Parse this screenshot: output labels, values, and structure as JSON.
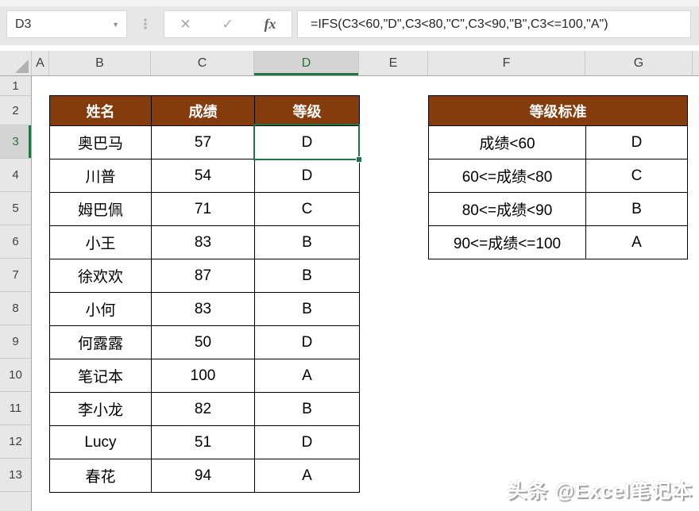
{
  "formula_bar": {
    "name_box_value": "D3",
    "cancel_icon": "✕",
    "enter_icon": "✓",
    "fx_label": "fx",
    "formula": "=IFS(C3<60,\"D\",C3<80,\"C\",C3<90,\"B\",C3<=100,\"A\")"
  },
  "grid": {
    "selected_cell": "D3",
    "column_headers": [
      "A",
      "B",
      "C",
      "D",
      "E",
      "F",
      "G"
    ],
    "row_headers": [
      "1",
      "2",
      "3",
      "4",
      "5",
      "6",
      "7",
      "8",
      "9",
      "10",
      "11",
      "12",
      "13"
    ]
  },
  "score_table": {
    "headers": [
      "姓名",
      "成绩",
      "等级"
    ],
    "rows": [
      {
        "name": "奥巴马",
        "score": "57",
        "grade": "D"
      },
      {
        "name": "川普",
        "score": "54",
        "grade": "D"
      },
      {
        "name": "姆巴佩",
        "score": "71",
        "grade": "C"
      },
      {
        "name": "小王",
        "score": "83",
        "grade": "B"
      },
      {
        "name": "徐欢欢",
        "score": "87",
        "grade": "B"
      },
      {
        "name": "小何",
        "score": "83",
        "grade": "B"
      },
      {
        "name": "何露露",
        "score": "50",
        "grade": "D"
      },
      {
        "name": "笔记本",
        "score": "100",
        "grade": "A"
      },
      {
        "name": "李小龙",
        "score": "82",
        "grade": "B"
      },
      {
        "name": "Lucy",
        "score": "51",
        "grade": "D"
      },
      {
        "name": "春花",
        "score": "94",
        "grade": "A"
      }
    ]
  },
  "grade_table": {
    "title": "等级标准",
    "rows": [
      {
        "range": "成绩<60",
        "grade": "D"
      },
      {
        "range": "60<=成绩<80",
        "grade": "C"
      },
      {
        "range": "80<=成绩<90",
        "grade": "B"
      },
      {
        "range": "90<=成绩<=100",
        "grade": "A"
      }
    ]
  },
  "watermark": "头条 @Excel笔记本",
  "colors": {
    "table_header_brown": "#843C0C",
    "selection_green": "#217346",
    "panel_gray": "#E7E7E7"
  }
}
